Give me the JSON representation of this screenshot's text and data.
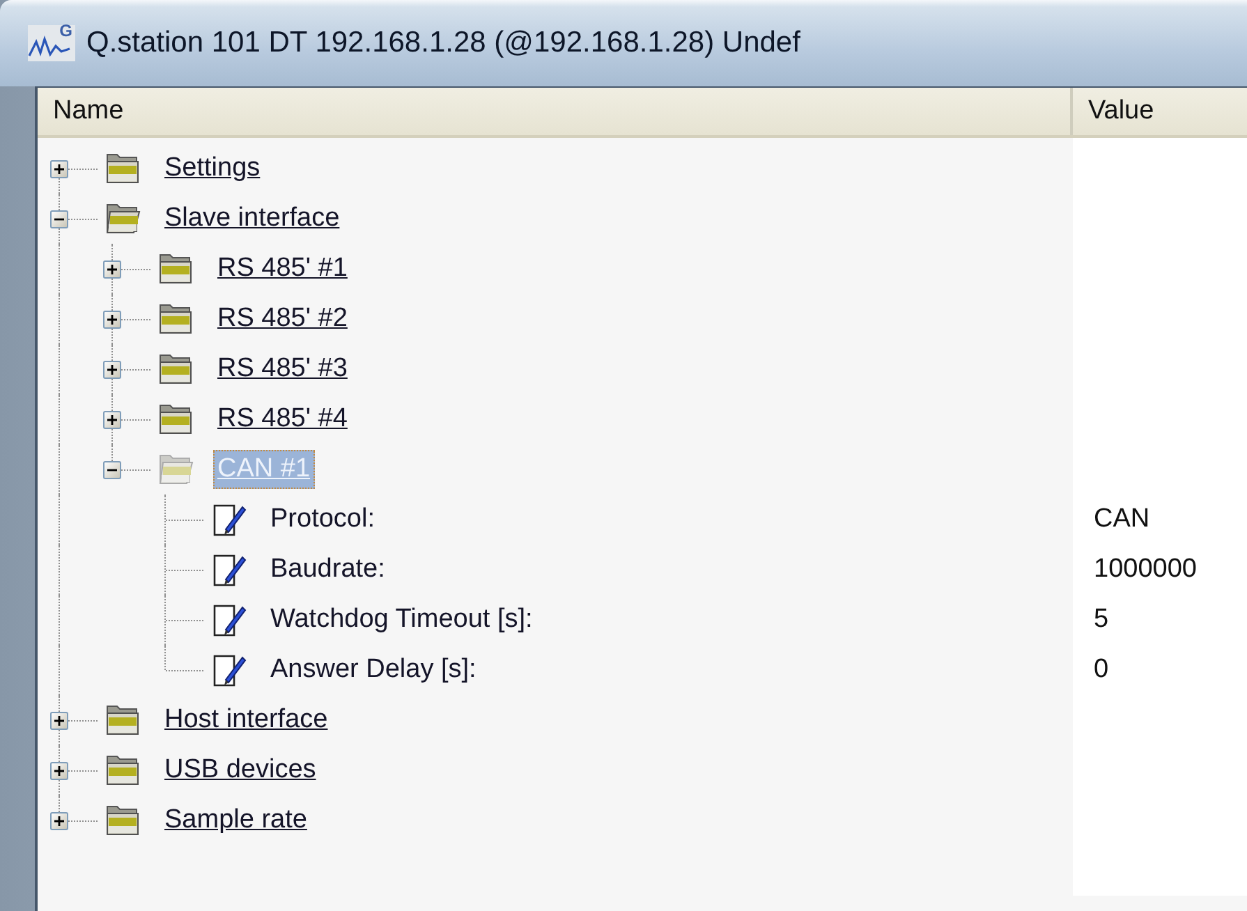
{
  "window": {
    "title": "Q.station 101 DT 192.168.1.28 (@192.168.1.28) Undef",
    "icon_letter": "G"
  },
  "columns": [
    {
      "label": "Name"
    },
    {
      "label": "Value"
    }
  ],
  "tree": [
    {
      "kind": "folder",
      "label": "Settings",
      "expanded": false,
      "selected": false
    },
    {
      "kind": "folder",
      "label": "Slave interface",
      "expanded": true,
      "selected": false,
      "children": [
        {
          "kind": "folder",
          "label": "RS 485' #1",
          "expanded": false,
          "selected": false
        },
        {
          "kind": "folder",
          "label": "RS 485' #2",
          "expanded": false,
          "selected": false
        },
        {
          "kind": "folder",
          "label": "RS 485' #3",
          "expanded": false,
          "selected": false
        },
        {
          "kind": "folder",
          "label": "RS 485' #4",
          "expanded": false,
          "selected": false
        },
        {
          "kind": "folder",
          "label": "CAN #1",
          "expanded": true,
          "selected": true,
          "children": [
            {
              "kind": "field",
              "label": "Protocol:",
              "value": "CAN",
              "selected": false
            },
            {
              "kind": "field",
              "label": "Baudrate:",
              "value": "1000000",
              "selected": false
            },
            {
              "kind": "field",
              "label": "Watchdog Timeout [s]:",
              "value": "5",
              "selected": false
            },
            {
              "kind": "field",
              "label": "Answer Delay [s]:",
              "value": "0",
              "selected": false
            }
          ]
        }
      ]
    },
    {
      "kind": "folder",
      "label": "Host interface",
      "expanded": false,
      "selected": false
    },
    {
      "kind": "folder",
      "label": "USB devices",
      "expanded": false,
      "selected": false
    },
    {
      "kind": "folder",
      "label": "Sample rate",
      "expanded": false,
      "selected": false
    }
  ]
}
